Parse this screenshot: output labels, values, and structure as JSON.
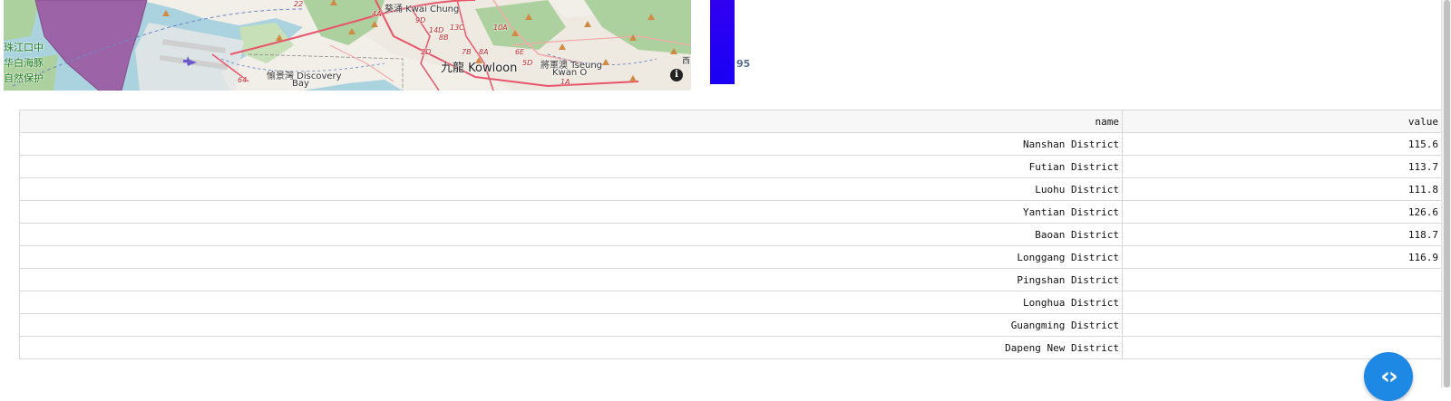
{
  "map": {
    "labels": {
      "kwai_chung": "葵涌 Kwai Chung",
      "kowloon": "九龍 Kowloon",
      "discovery_bay": "愉景灣 Discovery",
      "discovery_bay_2": "Bay",
      "tseung_kwan_o": "將軍澳 Tseung",
      "tseung_kwan_o_2": "Kwan O",
      "estuary_1": "珠江口中",
      "estuary_2": "华白海豚",
      "estuary_3": "自然保护",
      "route_r22": "22",
      "route_4a": "4A",
      "route_9d": "9D",
      "route_13c": "13C",
      "route_10a": "10A",
      "route_14d": "14D",
      "route_8b": "8B",
      "route_2d": "2D",
      "route_7b": "7B",
      "route_8a": "8A",
      "route_6e": "6E",
      "route_5d": "5D",
      "route_64": "64",
      "route_1a": "1A",
      "west_edge": "西"
    },
    "info_symbol": "i",
    "colors": {
      "water": "#aad3df",
      "land": "#f2efe9",
      "green": "#add19e",
      "protected_area": "#9b59a0",
      "roads": "#e8556a"
    },
    "icon": "info-icon"
  },
  "legend": {
    "tick_label": "95",
    "color": "#2200f2"
  },
  "table": {
    "headers": [
      "name",
      "value"
    ],
    "rows": [
      [
        "Nanshan District",
        "115.6"
      ],
      [
        "Futian District",
        "113.7"
      ],
      [
        "Luohu District",
        "111.8"
      ],
      [
        "Yantian District",
        "126.6"
      ],
      [
        "Baoan District",
        "118.7"
      ],
      [
        "Longgang District",
        "116.9"
      ],
      [
        "Pingshan District",
        ""
      ],
      [
        "Longhua District",
        ""
      ],
      [
        "Guangming District",
        ""
      ],
      [
        "Dapeng New District",
        ""
      ]
    ]
  },
  "floating_button": {
    "symbol": "‹›",
    "icon": "code-icon",
    "color": "#1e88e5"
  }
}
